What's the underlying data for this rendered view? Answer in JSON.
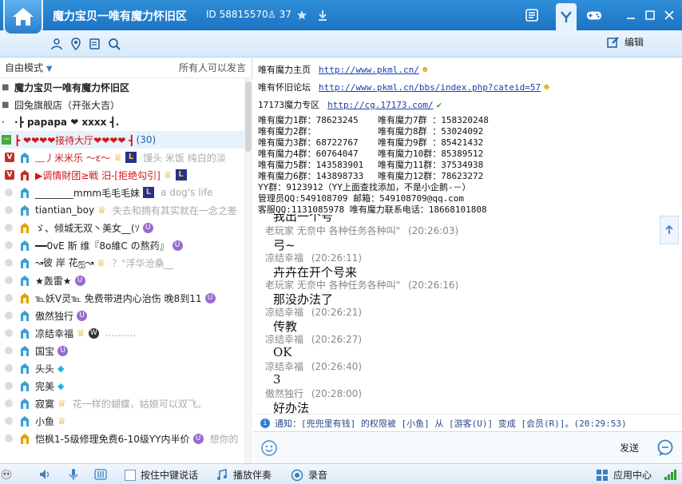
{
  "window": {
    "title": "魔力宝贝一唯有魔力怀旧区",
    "room_id": "ID 58815570",
    "online_count": "37"
  },
  "toolbar": {
    "edit_label": "编辑"
  },
  "left": {
    "mode_label": "自由模式",
    "permission_label": "所有人可以发言",
    "channels": [
      {
        "text": "魔力宝贝一唯有魔力怀旧区"
      },
      {
        "text": "囧兔旗舰店（开张大吉）"
      },
      {
        "text": "·┣ papapa ❤ xxxx ┫."
      },
      {
        "text": "┣ ❤❤❤❤接待大厅❤❤❤❤ ┫",
        "count": "(30)"
      }
    ],
    "members": [
      {
        "name": "﹏丿米米乐 〜ε〜",
        "sig": "馒头 米饭 纯白的淡"
      },
      {
        "name": "▶调情財团≥戦  汨-[拒绝勾引]",
        "sig": ""
      },
      {
        "name": "________mmm毛毛毛妹",
        "sig": "a dog's life"
      },
      {
        "name": "tiantian_boy",
        "sig": "失去和拥有其实就在一念之差"
      },
      {
        "name": "ゞ、倾城无双丶美女__(ｿ",
        "sig": ""
      },
      {
        "name": "━━0vE 斯  维『8ο維C の熬药』",
        "sig": ""
      },
      {
        "name": "↝彼 岸 花ஐ↝",
        "sig": "？\"浮华沧桑__"
      },
      {
        "name": "★轰雷★",
        "sig": ""
      },
      {
        "name": "℡妖V灵℡ 免费带进内心治伤 晚8到11",
        "sig": ""
      },
      {
        "name": "傲然独行",
        "sig": ""
      },
      {
        "name": "凉结幸福",
        "sig": ".........."
      },
      {
        "name": "国宝",
        "sig": ""
      },
      {
        "name": "头头",
        "sig": ""
      },
      {
        "name": "完美",
        "sig": ""
      },
      {
        "name": "寂寞",
        "sig": "花一样的蝴蝶，姑娘可以双飞。"
      },
      {
        "name": "小鱼",
        "sig": ""
      },
      {
        "name": "恺枫1-5级修理免费6-10级YY内半价",
        "sig": "想你的"
      }
    ]
  },
  "board": {
    "links": [
      {
        "label": "唯有魔力主页",
        "url": "http://www.pkml.cn/"
      },
      {
        "label": "唯有怀旧论坛",
        "url": "http://www.pkml.cn/bbs/index.php?cateid=57"
      },
      {
        "label": "17173魔力专区",
        "url": "http://cg.17173.com/"
      }
    ],
    "qq_groups": [
      [
        "唯有魔力1群：78623245",
        "唯有魔力7群 ：158320248"
      ],
      [
        "唯有魔力2群：",
        "唯有魔力8群 ：53024092"
      ],
      [
        "唯有魔力3群：68722767",
        "唯有魔力9群 ：85421432"
      ],
      [
        "唯有魔力4群：60764047",
        "唯有魔力10群：85389512"
      ],
      [
        "唯有魔力5群：143583901",
        "唯有魔力11群：37534938"
      ],
      [
        "唯有魔力6群：143898733",
        "唯有魔力12群：78623272"
      ]
    ],
    "yy_group": "YY群：9123912（YY上面查找添加，不是小企鹅-－）",
    "admin": "管理员QQ:549108709   邮箱：549108709@qq.com",
    "service": "客服QQ:1131085978   唯有魔力联系电话：18668101808"
  },
  "chat": {
    "messages": [
      {
        "nick": "老玩家 无奈中 各种任务各种叫\"",
        "time": "(20:26:03)",
        "text": "弓~"
      },
      {
        "nick": "凉结幸福",
        "time": "(20:26:11)",
        "text": "卉卉在开个号来"
      },
      {
        "nick": "老玩家 无奈中 各种任务各种叫\"",
        "time": "(20:26:16)",
        "text": "那没办法了"
      },
      {
        "nick": "凉结幸福",
        "time": "(20:26:21)",
        "text": "传教"
      },
      {
        "nick": "凉结幸福",
        "time": "(20:26:27)",
        "text": "OK"
      },
      {
        "nick": "凉结幸福",
        "time": "(20:26:40)",
        "text": "3"
      },
      {
        "nick": "傲然独行",
        "time": "(20:28:00)",
        "text": "好办法"
      }
    ],
    "partial_top": "我出一个号",
    "notice": "通知：[兜兜里有钱] 的权限被 [小鱼] 从 [游客(U)] 变成 [会员(R)]。(20:29:53)"
  },
  "input": {
    "send_label": "发送"
  },
  "bottom": {
    "ptt_label": "按住中键说话",
    "accompany_label": "播放伴奏",
    "record_label": "录音",
    "app_center_label": "应用中心"
  },
  "colors": {
    "title_bar": "#1d73c4",
    "channel_red": "#d4141a",
    "count_blue": "#1a5fb0",
    "link_blue": "#1a3fa8"
  }
}
